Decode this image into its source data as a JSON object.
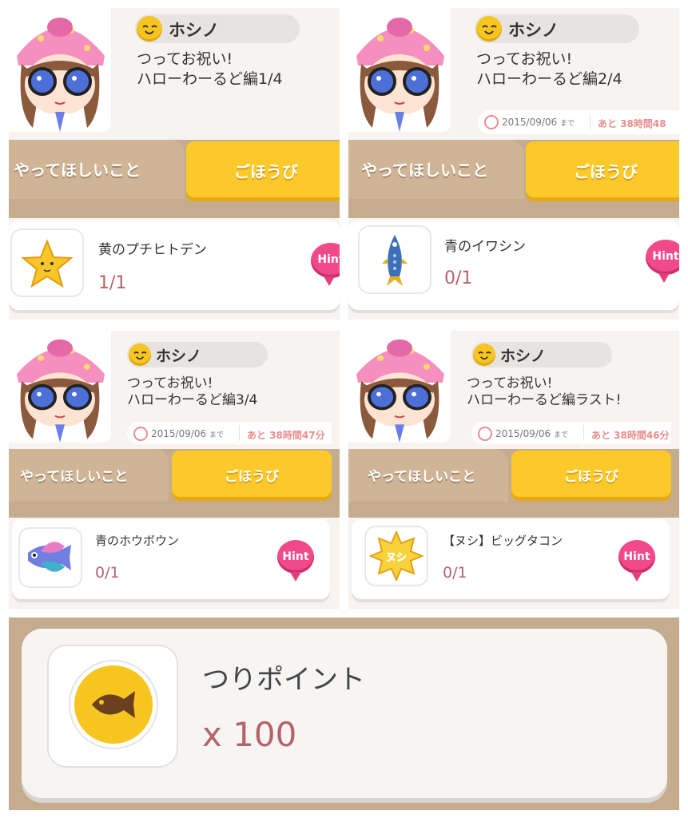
{
  "colors": {
    "tab_brown": "#c6ac8f",
    "tab_yellow": "#fbca2a",
    "hint_pink": "#f04a8a",
    "progress_red": "#b5636a"
  },
  "panels": [
    {
      "npc_name": "ホシノ",
      "quest_title": "つってお祝い!\nハローわーるど編1/4",
      "tab_request": "やってほしいこと",
      "tab_reward": "ごほうび",
      "item_icon": "yellow-starfish-icon",
      "item_name": "黄のプチヒトデン",
      "progress": "1/1",
      "hint": "Hint"
    },
    {
      "npc_name": "ホシノ",
      "quest_title": "つってお祝い!\nハローわーるど編2/4",
      "deadline_date": "2015/09/06",
      "deadline_suffix": "まで",
      "remaining": "あと 38時間48",
      "tab_request": "やってほしいこと",
      "tab_reward": "ごほうび",
      "item_icon": "blue-sardine-icon",
      "item_name": "青のイワシン",
      "progress": "0/1",
      "hint": "Hint"
    },
    {
      "npc_name": "ホシノ",
      "quest_title": "つってお祝い!\nハローわーるど編3/4",
      "deadline_date": "2015/09/06",
      "deadline_suffix": "まで",
      "remaining": "あと 38時間47分",
      "tab_request": "やってほしいこと",
      "tab_reward": "ごほうび",
      "item_icon": "blue-gurnard-icon",
      "item_name": "青のホウボウン",
      "progress": "0/1",
      "hint": "Hint"
    },
    {
      "npc_name": "ホシノ",
      "quest_title": "つってお祝い!\nハローわーるど編ラスト!",
      "deadline_date": "2015/09/06",
      "deadline_suffix": "まで",
      "remaining": "あと 38時間46分",
      "tab_request": "やってほしいこと",
      "tab_reward": "ごほうび",
      "item_icon": "boss-octopus-badge-icon",
      "item_badge": "ヌシ",
      "item_name": "【ヌシ】ビッグタコン",
      "progress": "0/1",
      "hint": "Hint"
    }
  ],
  "reward": {
    "icon": "fish-coin-icon",
    "title": "つりポイント",
    "amount": "x 100"
  }
}
